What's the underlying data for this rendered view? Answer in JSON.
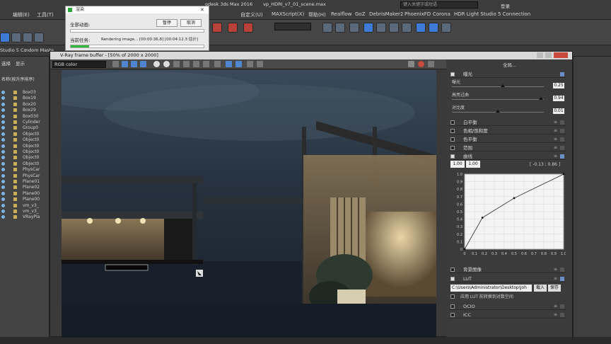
{
  "app": {
    "title_fragment": "odesk 3ds Max 2016",
    "file_fragment": "vp_HDRI_v7_01_scene.max",
    "menu": [
      "编辑(E)",
      "工具(T)",
      "自定义(U)",
      "MAXScript(X)",
      "帮助(H)",
      "Realflow",
      "GoZ",
      "DebrisMaker2",
      "PhoenixFD",
      "Corona",
      "HDR Light Studio 5 Connection"
    ],
    "search_placeholder": "键入关键字或短语",
    "login_label": "登录",
    "selection_set": "全部"
  },
  "tabs": [
    "Studio 5 Co",
    "ndom Maste"
  ],
  "explorer": {
    "header_select": "选择",
    "header_display": "显示",
    "column_header": "名称(按升序排序)",
    "items": [
      "Box03",
      "Box19",
      "Box20",
      "Box29",
      "Box030",
      "Cylinder",
      "Group0",
      "Object0",
      "Object0",
      "Object0",
      "Object0",
      "Object0",
      "Object0",
      "PhysCar",
      "PhysCar",
      "Plane01",
      "Plane02",
      "Plane00",
      "Plane00",
      "vm_v3_",
      "vm_v3_",
      "VRayPla"
    ]
  },
  "progress_dialog": {
    "title": "渲染",
    "total_label": "全部动画:",
    "pause_label": "暂停",
    "cancel_label": "取消",
    "current_label": "当前任务:",
    "current_task": "Rendering image... [00:00:36.8] [00:04:12.3 估计]",
    "total_progress": 0,
    "task_progress": 0.14
  },
  "vfb": {
    "title": "V-Ray frame buffer - [50% of 2000 x 2000]",
    "channel": "RGB color",
    "panel_top_label": "全局..."
  },
  "side_panel": {
    "exposure": {
      "label": "曝光",
      "checked": true
    },
    "sliders": [
      {
        "label": "曝光",
        "value": "0.25",
        "pos": 0.55
      },
      {
        "label": "高亮过曲",
        "value": "0.94",
        "pos": 0.97
      },
      {
        "label": "对比度",
        "value": "0.01",
        "pos": 0.5
      }
    ],
    "sections": [
      {
        "label": "白平衡",
        "checked": false
      },
      {
        "label": "色相/饱和度",
        "checked": false
      },
      {
        "label": "色平衡",
        "checked": false
      },
      {
        "label": "范围",
        "checked": false
      },
      {
        "label": "曲线",
        "checked": true
      }
    ],
    "curve": {
      "in_value": "1.00",
      "out_value": "1.00",
      "readout": "[ -0.13 ; 0.86 ]",
      "ticks": [
        "0",
        "0.1",
        "0.2",
        "0.3",
        "0.4",
        "0.5",
        "0.6",
        "0.7",
        "0.8",
        "0.9",
        "1.0"
      ],
      "points": [
        [
          0,
          0
        ],
        [
          0.18,
          0.42
        ],
        [
          0.5,
          0.68
        ],
        [
          1,
          1
        ]
      ]
    },
    "bottom_sections": [
      {
        "label": "背景图像",
        "checked": false
      },
      {
        "label": "LUT",
        "checked": true
      },
      {
        "label": "OCIO",
        "checked": false
      },
      {
        "label": "ICC",
        "checked": false
      }
    ],
    "lut": {
      "path": "C:\\Users\\Administrator\\Desktop\\Joh",
      "load_label": "载入",
      "save_label": "保存",
      "log_option": "应用 LUT 前转换到对数空间"
    }
  }
}
